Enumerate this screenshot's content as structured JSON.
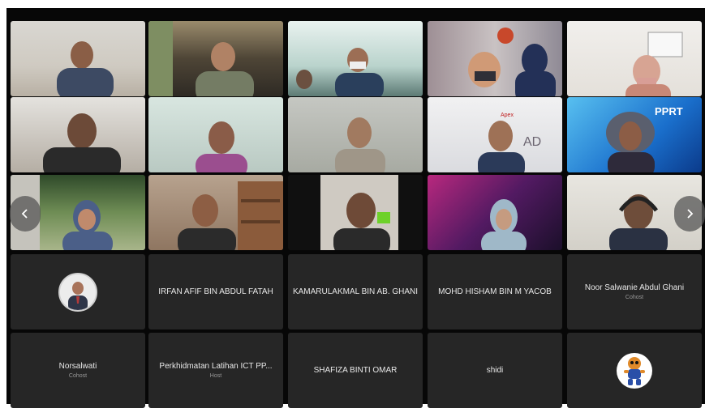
{
  "navigation": {
    "prev_icon": "chevron-left-icon",
    "next_icon": "chevron-right-icon"
  },
  "name_tiles": [
    {
      "name": "IRFAN AFIF BIN ABDUL FATAH",
      "role": ""
    },
    {
      "name": "KAMARULAKMAL BIN AB. GHANI",
      "role": ""
    },
    {
      "name": "MOHD HISHAM BIN M YACOB",
      "role": ""
    },
    {
      "name": "Noor Salwanie Abdul Ghani",
      "role": "Cohost"
    },
    {
      "name": "Norsalwati",
      "role": "Cohost"
    },
    {
      "name": "Perkhidmatan Latihan ICT PP...",
      "role": "Host"
    },
    {
      "name": "SHAFIZA BINTI OMAR",
      "role": ""
    },
    {
      "name": "shidi",
      "role": ""
    }
  ],
  "avatars": {
    "profile_photo_icon": "profile-photo-icon",
    "mascot_icon": "cartoon-mascot-icon"
  },
  "video_backgrounds": {
    "v1": "PPRT",
    "v2": "AD",
    "v3": "Apex"
  },
  "colors": {
    "stage_background": "#070707",
    "tile_background": "#262626",
    "name_text": "#e8e8e8",
    "role_text": "#9a9a9a"
  }
}
